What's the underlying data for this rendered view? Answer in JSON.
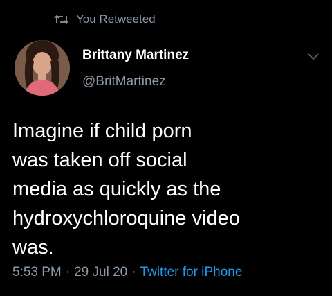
{
  "retweet": {
    "label": "You Retweeted",
    "icon": "retweet-icon"
  },
  "author": {
    "name": "Brittany Martinez",
    "handle": "@BritMartinez"
  },
  "tweet": {
    "text": "Imagine if child porn\nwas taken off social\nmedia as quickly as the\nhydroxychloroquine video\nwas."
  },
  "meta": {
    "time": "5:53 PM",
    "dot1": "·",
    "date": "29 Jul 20",
    "dot2": "·",
    "source": "Twitter for iPhone"
  },
  "colors": {
    "background": "#000000",
    "text_primary": "#ffffff",
    "text_secondary": "#8b98a5",
    "link": "#1d9bf0"
  }
}
